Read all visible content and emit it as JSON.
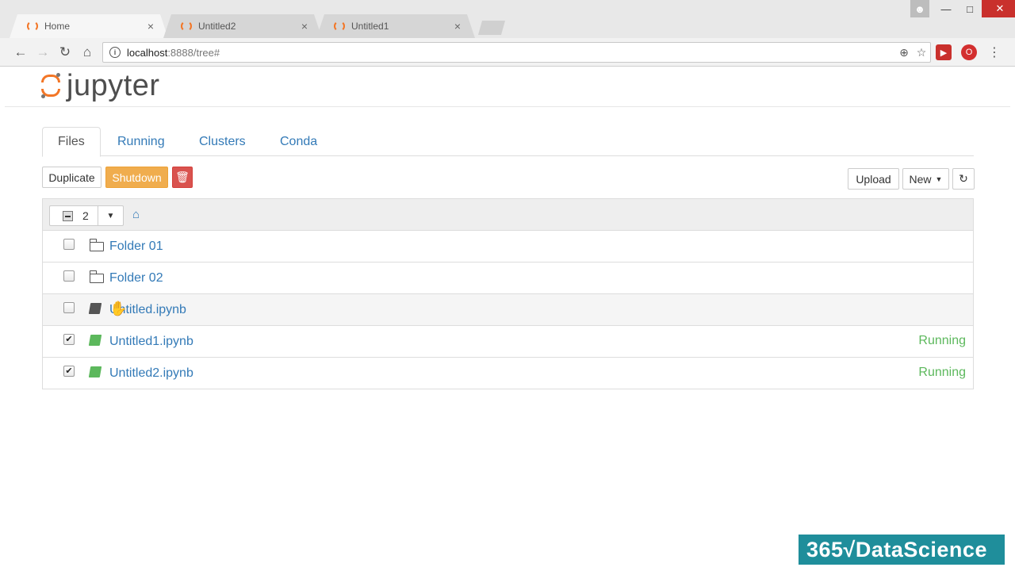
{
  "browser": {
    "tabs": [
      {
        "title": "Home",
        "active": true
      },
      {
        "title": "Untitled2",
        "active": false
      },
      {
        "title": "Untitled1",
        "active": false
      }
    ],
    "tab_close_glyph": "×",
    "url_host": "localhost",
    "url_rest": ":8888/tree#"
  },
  "jupyter": {
    "logo_text": "jupyter",
    "nav_tabs": [
      "Files",
      "Running",
      "Clusters",
      "Conda"
    ],
    "active_tab": "Files",
    "buttons": {
      "duplicate": "Duplicate",
      "shutdown": "Shutdown",
      "upload": "Upload",
      "new": "New"
    },
    "selected_count": "2",
    "files": [
      {
        "name": "Folder 01",
        "type": "folder",
        "checked": false,
        "status": ""
      },
      {
        "name": "Folder 02",
        "type": "folder",
        "checked": false,
        "status": ""
      },
      {
        "name": "Untitled.ipynb",
        "type": "notebook",
        "checked": false,
        "status": ""
      },
      {
        "name": "Untitled1.ipynb",
        "type": "notebook",
        "checked": true,
        "status": "Running"
      },
      {
        "name": "Untitled2.ipynb",
        "type": "notebook",
        "checked": true,
        "status": "Running"
      }
    ]
  },
  "watermark": {
    "text": "365√DataScience"
  },
  "colors": {
    "accent": "#f37626",
    "link": "#337ab7",
    "running": "#5cb85c",
    "warning": "#f0ad4e",
    "danger": "#d9534f",
    "brand": "#1f8e9b"
  }
}
